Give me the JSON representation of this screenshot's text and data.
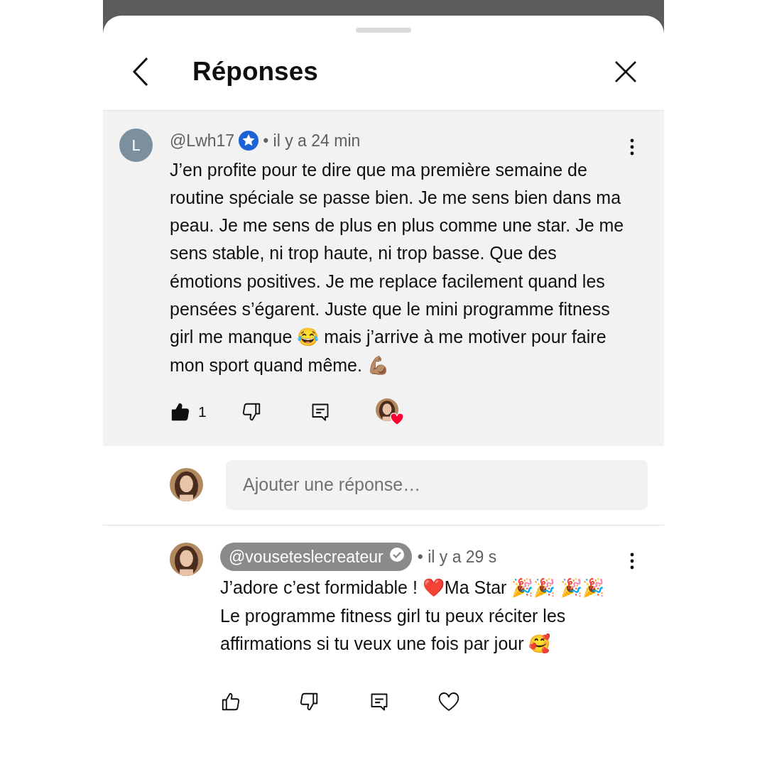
{
  "header": {
    "title": "Réponses"
  },
  "comment": {
    "avatar_letter": "L",
    "author": "@Lwh17",
    "time": "• il y a 24 min",
    "text": "J’en profite pour te dire que ma première semaine de routine spéciale se passe bien. Je me sens bien dans ma peau. Je me sens de plus en plus comme une star. Je me sens stable, ni trop haute, ni trop basse. Que des émotions positives. Je me replace facilement quand les pensées s’égarent. Juste que le mini programme fitness girl me manque 😂 mais j’arrive à me motiver pour faire mon sport quand même. 💪🏽",
    "likes": "1",
    "liked": true,
    "creator_hearted": true
  },
  "reply_field": {
    "placeholder": "Ajouter une réponse…"
  },
  "reply": {
    "author": "@vouseteslecreateur",
    "time": "• il y a 29 s",
    "text": "J’adore c’est formidable ! ❤️Ma Star 🎉🎉 🎉🎉 Le programme fitness girl tu peux réciter les affirmations si tu veux une fois par jour 🥰",
    "liked": false,
    "creator_hearted": false
  }
}
